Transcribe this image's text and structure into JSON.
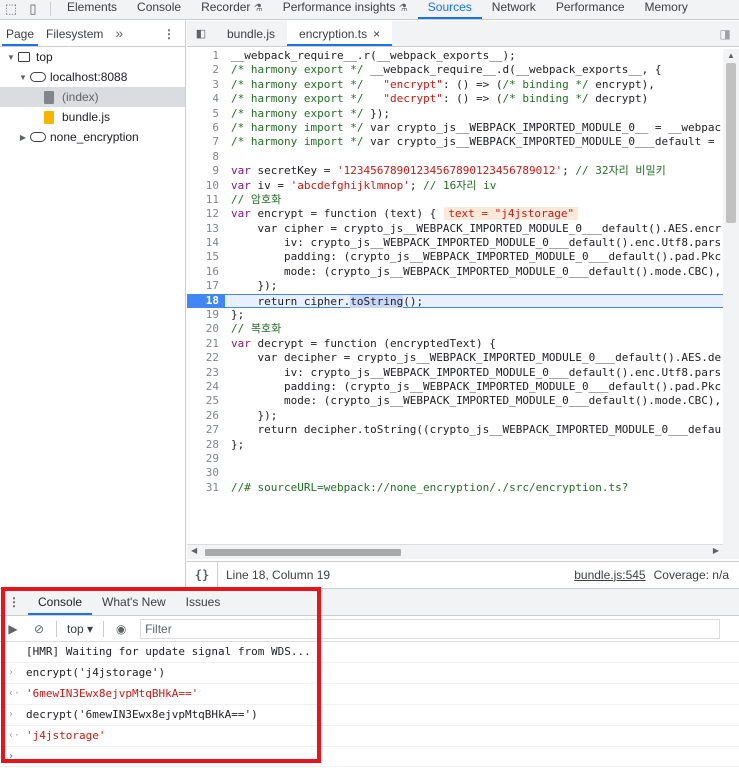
{
  "toolbar": {
    "tabs": [
      {
        "label": "Elements"
      },
      {
        "label": "Console"
      },
      {
        "label": "Recorder"
      },
      {
        "label": "Performance insights"
      },
      {
        "label": "Sources"
      },
      {
        "label": "Network"
      },
      {
        "label": "Performance"
      },
      {
        "label": "Memory"
      }
    ],
    "active_tab": "Sources",
    "accent_color": "#1a73e8"
  },
  "navigator": {
    "tabs": [
      {
        "label": "Page"
      },
      {
        "label": "Filesystem"
      }
    ],
    "more": "»",
    "tree": [
      {
        "label": "top"
      },
      {
        "label": "localhost:8088"
      },
      {
        "label": "(index)"
      },
      {
        "label": "bundle.js"
      },
      {
        "label": "none_encryption"
      }
    ]
  },
  "editor": {
    "tabs": [
      {
        "label": "bundle.js"
      },
      {
        "label": "encryption.ts"
      }
    ],
    "close_glyph": "×",
    "paused_line": 18,
    "inline_value": "text = \"j4jstorage\"",
    "status": {
      "position": "Line 18, Column 19",
      "source_link": "bundle.js:545",
      "coverage": "Coverage: n/a"
    }
  },
  "code_lines": [
    "__webpack_require__.r(__webpack_exports__);",
    "/* harmony export */ __webpack_require__.d(__webpack_exports__, {",
    "/* harmony export */   \"encrypt\": () => (/* binding */ encrypt),",
    "/* harmony export */   \"decrypt\": () => (/* binding */ decrypt)",
    "/* harmony export */ });",
    "/* harmony import */ var crypto_js__WEBPACK_IMPORTED_MODULE_0__ = __webpac",
    "/* harmony import */ var crypto_js__WEBPACK_IMPORTED_MODULE_0___default =",
    "",
    "var secretKey = '12345678901234567890123456789012'; // 32자리 비밀키",
    "var iv = 'abcdefghijklmnop'; // 16자리 iv",
    "// 암호화",
    "var encrypt = function (text) {",
    "    var cipher = crypto_js__WEBPACK_IMPORTED_MODULE_0___default().AES.encr",
    "        iv: crypto_js__WEBPACK_IMPORTED_MODULE_0___default().enc.Utf8.pars",
    "        padding: (crypto_js__WEBPACK_IMPORTED_MODULE_0___default().pad.Pkc",
    "        mode: (crypto_js__WEBPACK_IMPORTED_MODULE_0___default().mode.CBC),",
    "    });",
    "    return cipher.toString();",
    "};",
    "// 복호화",
    "var decrypt = function (encryptedText) {",
    "    var decipher = crypto_js__WEBPACK_IMPORTED_MODULE_0___default().AES.de",
    "        iv: crypto_js__WEBPACK_IMPORTED_MODULE_0___default().enc.Utf8.pars",
    "        padding: (crypto_js__WEBPACK_IMPORTED_MODULE_0___default().pad.Pkc",
    "        mode: (crypto_js__WEBPACK_IMPORTED_MODULE_0___default().mode.CBC),",
    "    });",
    "    return decipher.toString((crypto_js__WEBPACK_IMPORTED_MODULE_0___defau",
    "};",
    "",
    "",
    "//# sourceURL=webpack://none_encryption/./src/encryption.ts?"
  ],
  "drawer": {
    "tabs": [
      {
        "label": "Console"
      },
      {
        "label": "What's New"
      },
      {
        "label": "Issues"
      }
    ],
    "context": "top",
    "filter_placeholder": "Filter",
    "messages": [
      {
        "type": "log",
        "text": "[HMR] Waiting for update signal from WDS..."
      },
      {
        "type": "input",
        "text": "encrypt('j4jstorage')"
      },
      {
        "type": "result",
        "text": "'6mewIN3Ewx8ejvpMtqBHkA=='"
      },
      {
        "type": "input",
        "text": "decrypt('6mewIN3Ewx8ejvpMtqBHkA==')"
      },
      {
        "type": "result",
        "text": "'j4jstorage'"
      },
      {
        "type": "prompt",
        "text": ""
      }
    ],
    "highlight_color": "#e8141c"
  }
}
